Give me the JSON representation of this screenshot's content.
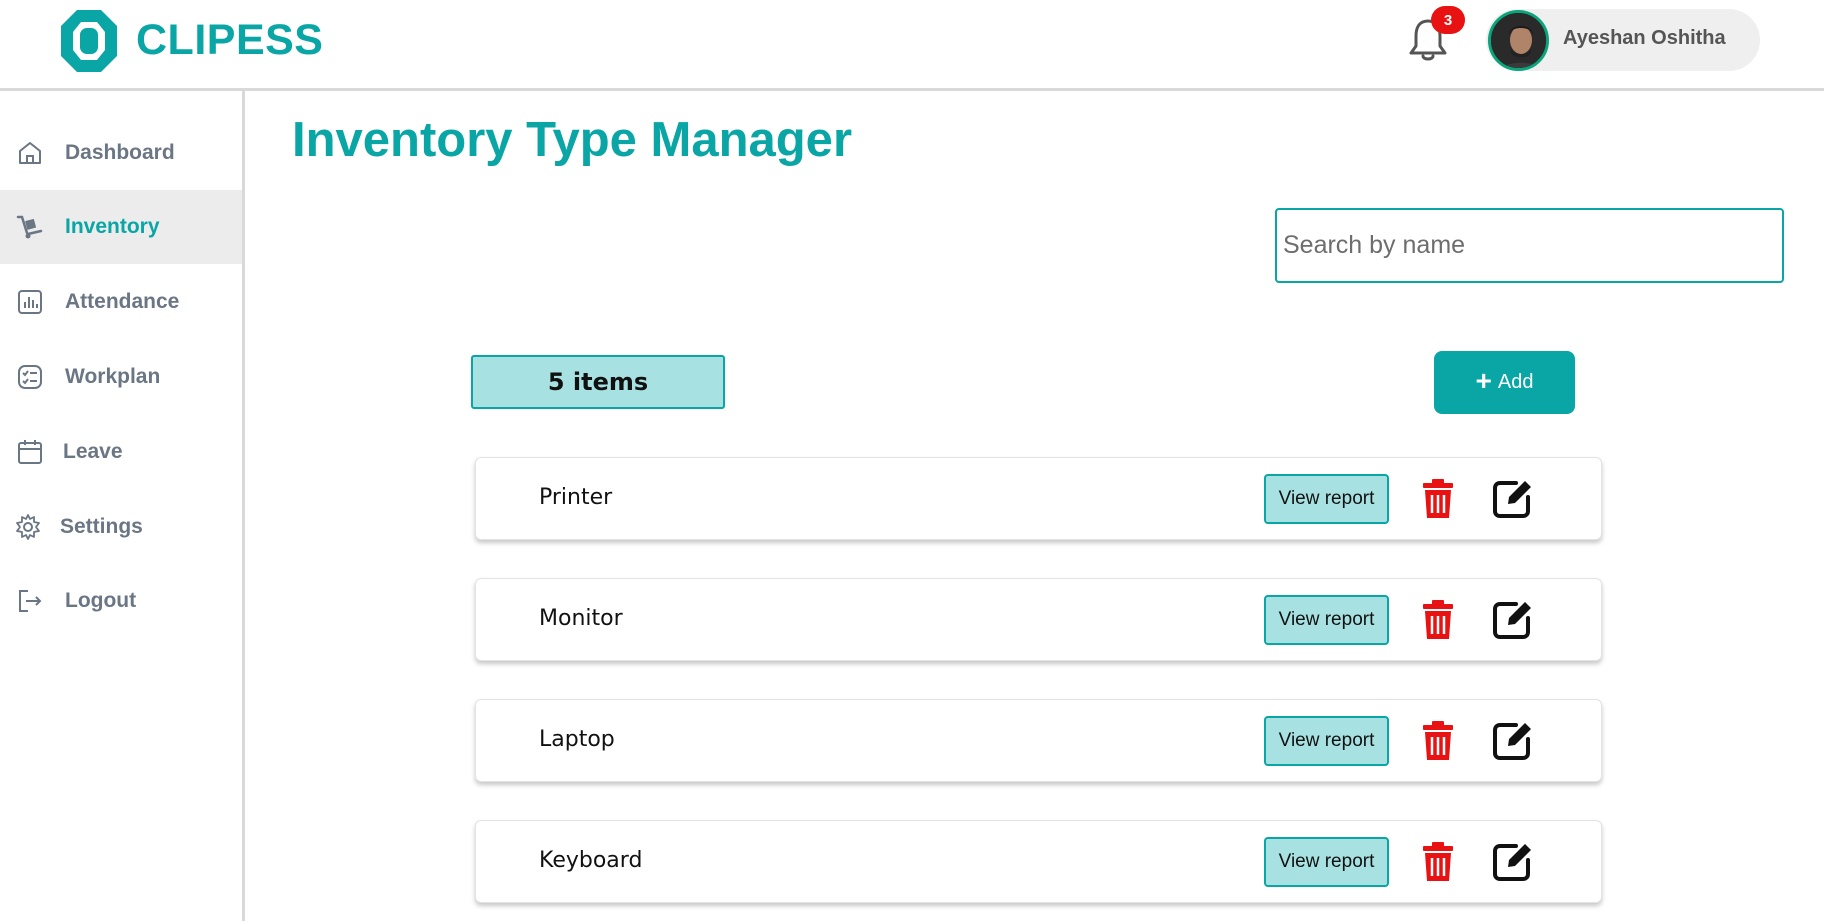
{
  "brand": {
    "name": "CLIPESS",
    "color": "#0aa5a5"
  },
  "header": {
    "notifications_count": "3",
    "user_name": "Ayeshan Oshitha"
  },
  "sidebar": {
    "items": [
      {
        "label": "Dashboard",
        "icon": "home-icon",
        "active": false
      },
      {
        "label": "Inventory",
        "icon": "dolly-icon",
        "active": true
      },
      {
        "label": "Attendance",
        "icon": "bar-chart-icon",
        "active": false
      },
      {
        "label": "Workplan",
        "icon": "checklist-icon",
        "active": false
      },
      {
        "label": "Leave",
        "icon": "calendar-icon",
        "active": false
      },
      {
        "label": "Settings",
        "icon": "gear-icon",
        "active": false
      },
      {
        "label": "Logout",
        "icon": "logout-icon",
        "active": false
      }
    ]
  },
  "main": {
    "title": "Inventory Type Manager",
    "search": {
      "placeholder": "Search by name",
      "value": ""
    },
    "count_label": "5 items",
    "add_button": {
      "icon": "plus-icon",
      "label": "Add"
    },
    "rows": [
      {
        "name": "Printer",
        "view_label": "View report"
      },
      {
        "name": "Monitor",
        "view_label": "View report"
      },
      {
        "name": "Laptop",
        "view_label": "View report"
      },
      {
        "name": "Keyboard",
        "view_label": "View report"
      }
    ]
  },
  "colors": {
    "accent": "#0aa5a5",
    "accent_light": "#a7e1e1",
    "danger": "#e81212"
  }
}
